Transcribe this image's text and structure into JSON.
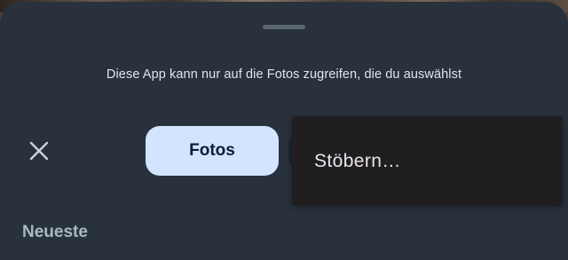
{
  "sheet": {
    "info_text": "Diese App kann nur auf die Fotos zugreifen, die du auswählst"
  },
  "tabs": {
    "photos_label": "Fotos"
  },
  "overflow_menu": {
    "items": [
      {
        "label": "Stöbern…"
      }
    ]
  },
  "section": {
    "label": "Neueste"
  },
  "icons": {
    "close": "close-icon"
  },
  "colors": {
    "sheet_background": "#29323c",
    "selected_tab": "#d3e4ff",
    "menu_background": "#211e22"
  }
}
